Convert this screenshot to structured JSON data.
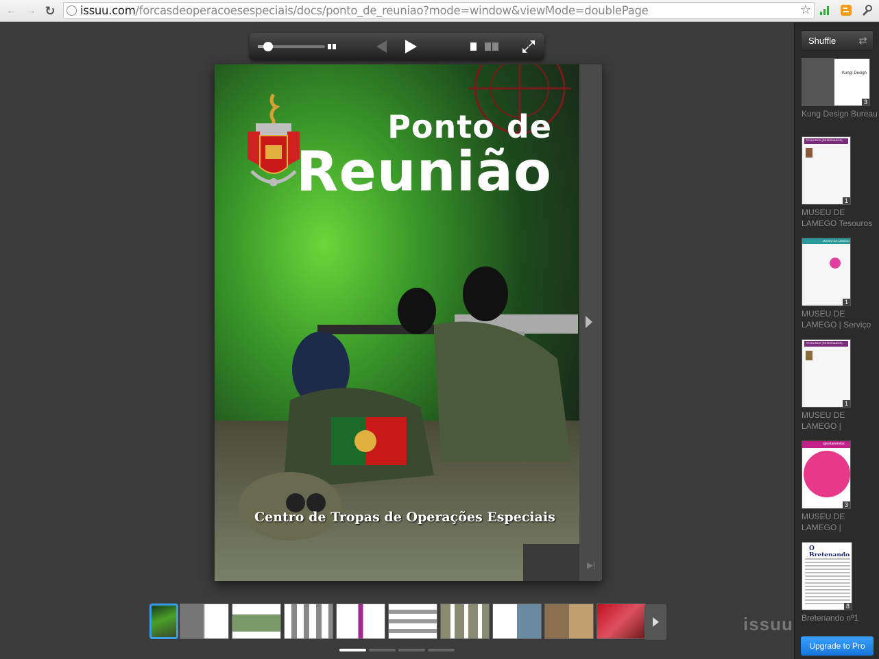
{
  "browser": {
    "url_host": "issuu.com",
    "url_path": "/forcasdeoperacoesespeciais/docs/ponto_de_reuniao?mode=window&viewMode=doublePage"
  },
  "cover": {
    "title_line1": "Ponto de",
    "title_line2": "Reunião",
    "subtitle": "Centro de Tropas de Operações Especiais"
  },
  "sidebar": {
    "shuffle_label": "Shuffle",
    "items": [
      {
        "title": "Kung Design Bureau",
        "badge": "3",
        "thumb_label": "Kung! Design"
      },
      {
        "title": "MUSEU DE LAMEGO Tesouros",
        "badge": "1",
        "thumb_label": "TESOUROS (RESERVADOS)"
      },
      {
        "title": "MUSEU DE LAMEGO | Serviço",
        "badge": "1",
        "thumb_label": "MUSEU DE LAMEGO"
      },
      {
        "title": "MUSEU DE LAMEGO |",
        "badge": "1",
        "thumb_label": "TESOUROS (RESERVADOS)"
      },
      {
        "title": "MUSEU DE LAMEGO |",
        "badge": "3",
        "thumb_label": "apontamentos"
      },
      {
        "title": "Bretenando nº1",
        "badge": "8",
        "thumb_label": "O Bretenando"
      }
    ],
    "upgrade_label": "Upgrade to Pro"
  },
  "logo": "issuu",
  "colors": {
    "accent": "#3b9de8",
    "upgrade": "#1e88e5"
  }
}
